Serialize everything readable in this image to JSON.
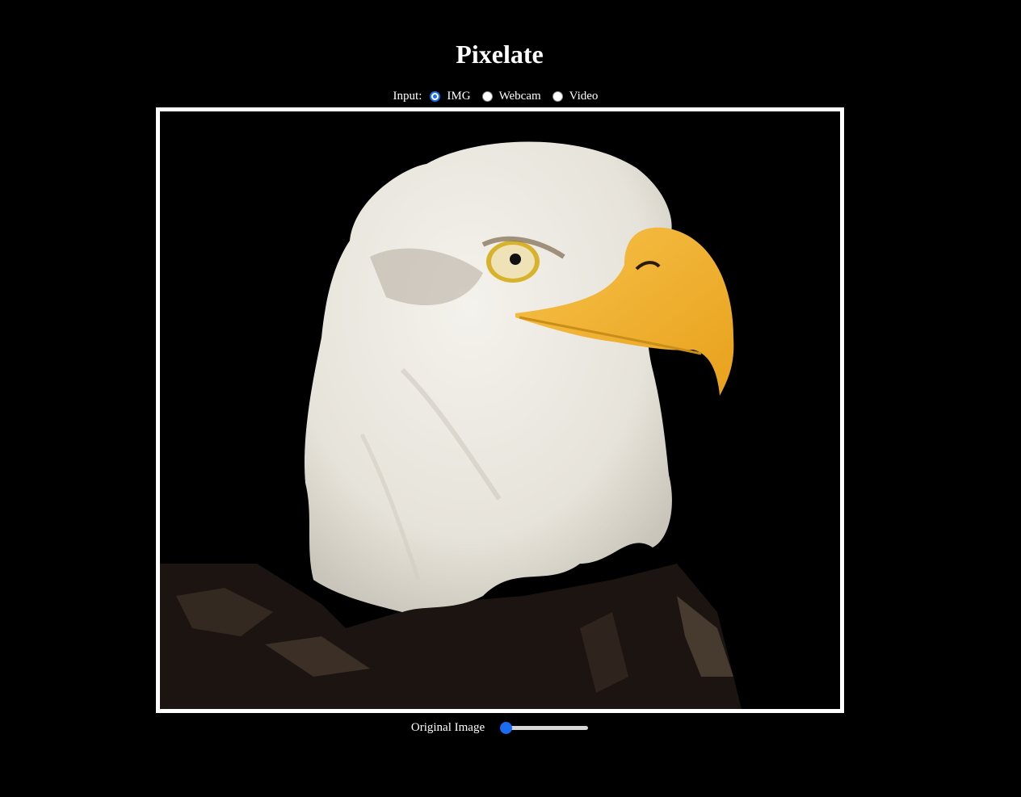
{
  "page": {
    "title": "Pixelate"
  },
  "input": {
    "label": "Input:",
    "options": [
      "IMG",
      "Webcam",
      "Video"
    ],
    "selected": "IMG"
  },
  "canvas": {
    "subject": "bald eagle photo"
  },
  "controls": {
    "mode_label": "Original Image",
    "slider_value": 0
  },
  "colors": {
    "background": "#000000",
    "frame": "#ffffff",
    "accent": "#1a6cf0"
  }
}
